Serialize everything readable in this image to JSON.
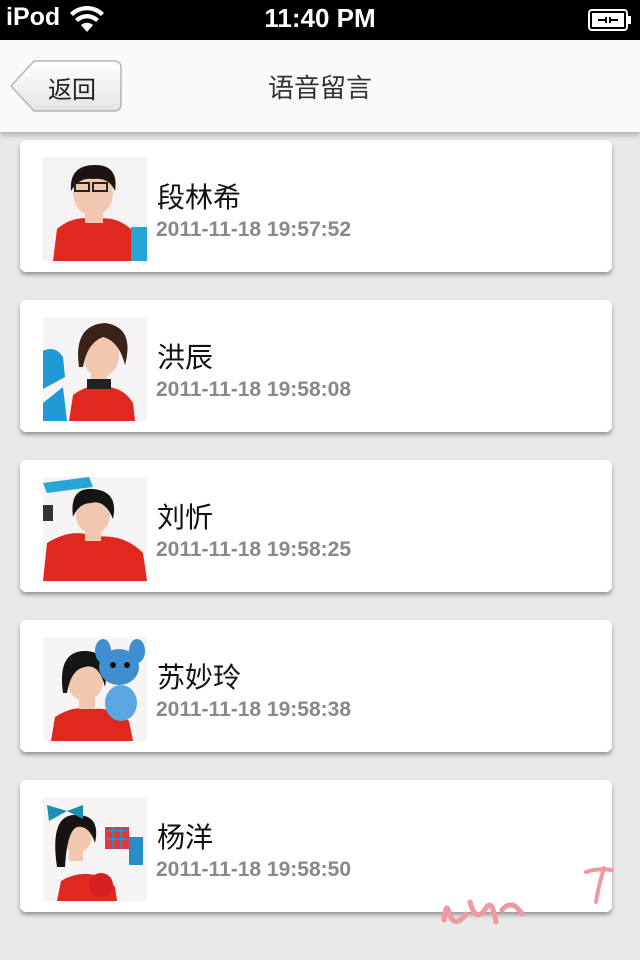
{
  "status_bar": {
    "carrier": "iPod",
    "time": "11:40 PM"
  },
  "nav": {
    "back_label": "返回",
    "title": "语音留言"
  },
  "messages": [
    {
      "name": "段林希",
      "timestamp": "2011-11-18 19:57:52"
    },
    {
      "name": "洪辰",
      "timestamp": "2011-11-18 19:58:08"
    },
    {
      "name": "刘忻",
      "timestamp": "2011-11-18 19:58:25"
    },
    {
      "name": "苏妙玲",
      "timestamp": "2011-11-18 19:58:38"
    },
    {
      "name": "杨洋",
      "timestamp": "2011-11-18 19:58:50"
    }
  ],
  "colors": {
    "background": "#e9e9e9",
    "card": "#ffffff",
    "timestamp": "#888888",
    "avatar_accent": "#e0281e"
  },
  "icons": [
    "wifi-icon",
    "battery-icon",
    "back-arrow-icon"
  ]
}
